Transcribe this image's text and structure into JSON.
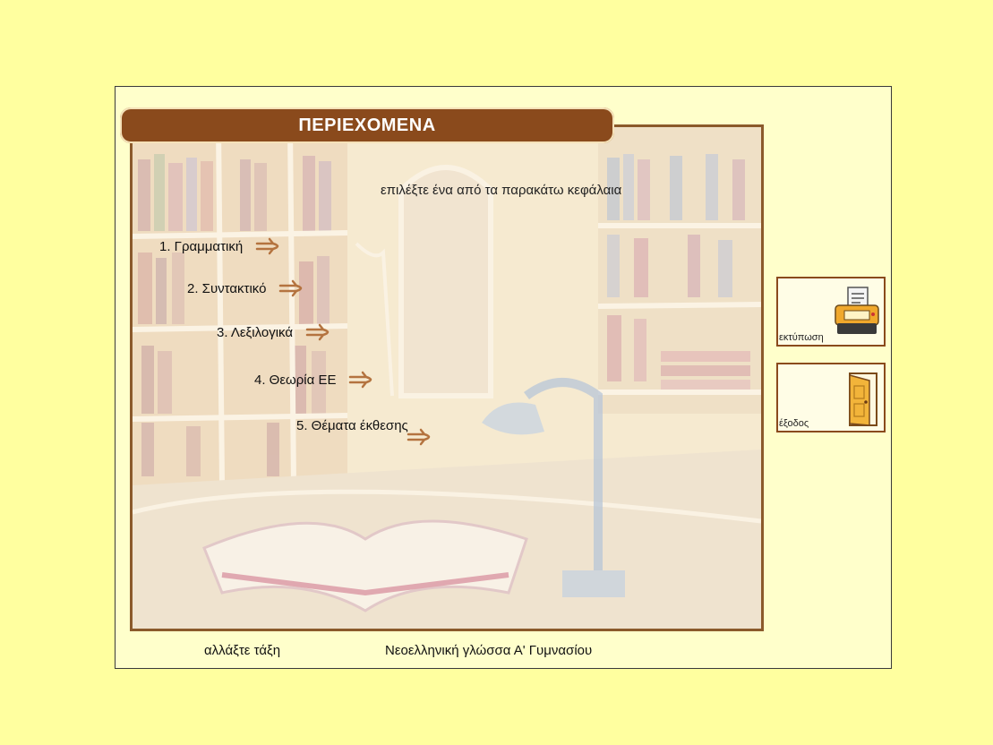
{
  "header": {
    "title": "ΠΕΡΙΕΧΟΜΕΝΑ"
  },
  "instruction": "επιλέξτε ένα από τα παρακάτω κεφάλαια",
  "menu": {
    "items": [
      {
        "label": "1. Γραμματική"
      },
      {
        "label": "2. Συντακτικό"
      },
      {
        "label": "3. Λεξιλογικά"
      },
      {
        "label": "4. Θεωρία ΕΕ"
      },
      {
        "label": "5. Θέματα έκθεσης"
      }
    ]
  },
  "side_buttons": {
    "print_label": "εκτύπωση",
    "exit_label": "έξοδος"
  },
  "footer": {
    "change_class": "αλλάξτε τάξη",
    "course_title": "Νεοελληνική γλώσσα Α' Γυμνασίου"
  },
  "colors": {
    "page_background": "#ffff9f",
    "panel_background": "#ffffcb",
    "title_bar": "#8a4a1c",
    "arrow": "#b4733f"
  }
}
